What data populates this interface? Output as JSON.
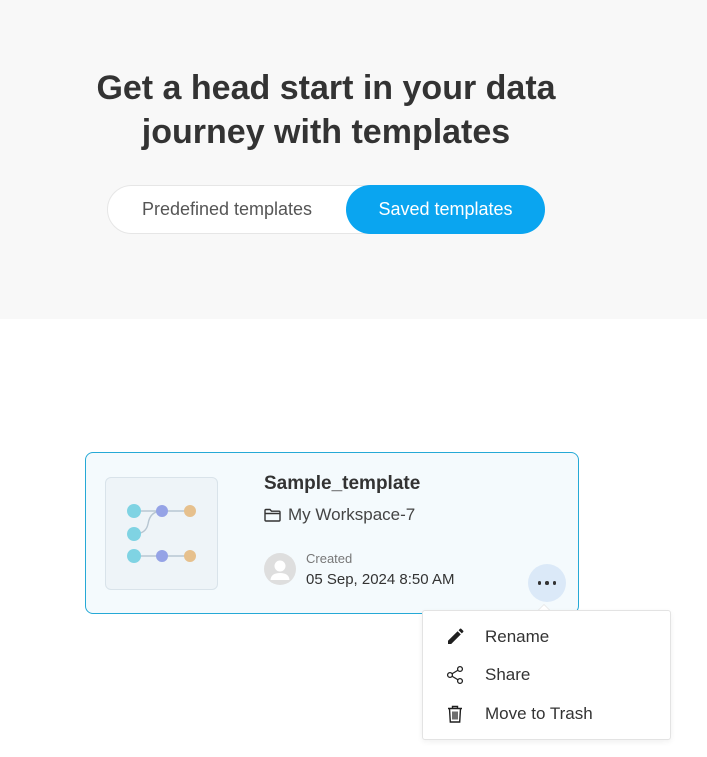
{
  "hero": {
    "title_line1": "Get a head start in your data",
    "title_line2": "journey with templates"
  },
  "tabs": {
    "predefined_label": "Predefined templates",
    "saved_label": "Saved templates",
    "active": "Saved templates"
  },
  "template_card": {
    "name": "Sample_template",
    "workspace": "My Workspace-7",
    "created_label": "Created",
    "created_date": "05 Sep, 2024 8:50 AM",
    "icons": {
      "workspace": "folder-icon",
      "creator": "user-avatar-icon",
      "more": "more-horizontal-icon",
      "thumbnail": "workflow-diagram-icon"
    }
  },
  "context_menu": {
    "items": [
      {
        "label": "Rename",
        "icon": "pencil-icon"
      },
      {
        "label": "Share",
        "icon": "share-icon"
      },
      {
        "label": "Move to Trash",
        "icon": "trash-icon"
      }
    ]
  },
  "colors": {
    "accent": "#0aa5f0",
    "card_border": "#25a9d6",
    "node_cyan": "#7fd3e3",
    "node_indigo": "#95a3e6",
    "node_orange": "#e6c08d"
  }
}
